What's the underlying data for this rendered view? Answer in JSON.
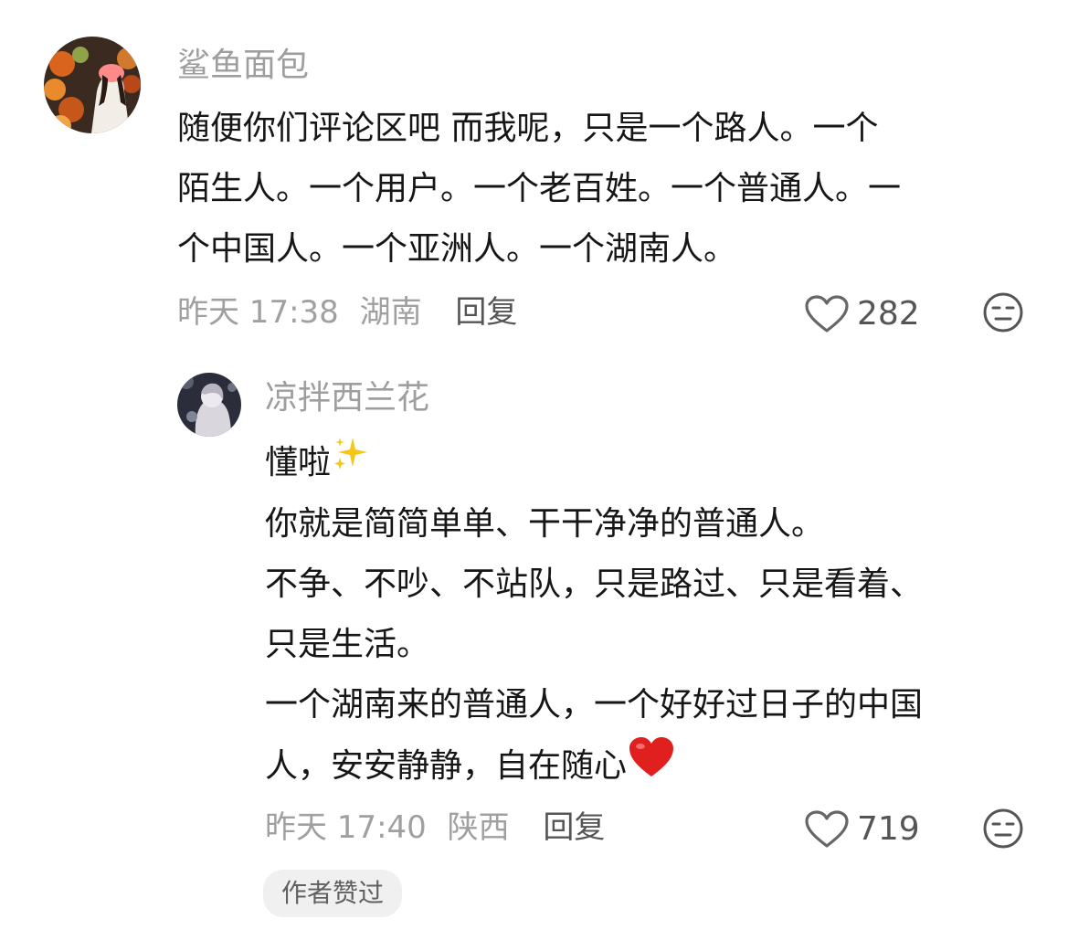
{
  "comment": {
    "username": "鲨鱼面包",
    "text_lines": [
      "随便你们评论区吧  而我呢，只是一个路人。一个",
      "陌生人。一个用户。一个老百姓。一个普通人。一",
      "个中国人。一个亚洲人。一个湖南人。"
    ],
    "time": "昨天 17:38",
    "location": "湖南",
    "reply_label": "回复",
    "like_count": "282",
    "icons": {
      "like": "heart-outline-icon",
      "dislike": "neutral-face-icon"
    }
  },
  "reply": {
    "username": "凉拌西兰花",
    "text_lines": [
      "懂啦",
      "你就是简简单单、干干净净的普通人。",
      "不争、不吵、不站队，只是路过、只是看着、",
      "只是生活。",
      "一个湖南来的普通人，一个好好过日子的中国",
      "人，安安静静，自在随心"
    ],
    "emojis": {
      "after_line_1": "sparkles-emoji",
      "after_line_6": "red-heart-emoji"
    },
    "time": "昨天 17:40",
    "location": "陕西",
    "reply_label": "回复",
    "like_count": "719",
    "author_liked_badge": "作者赞过",
    "icons": {
      "like": "heart-outline-icon",
      "dislike": "neutral-face-icon"
    }
  },
  "colors": {
    "username": "#9e9e9e",
    "text": "#161616",
    "meta": "#a0a0a0",
    "badge_bg": "#f0f0f0",
    "heart_emoji": "#e0201e",
    "sparkle_emoji": "#f5c518"
  }
}
